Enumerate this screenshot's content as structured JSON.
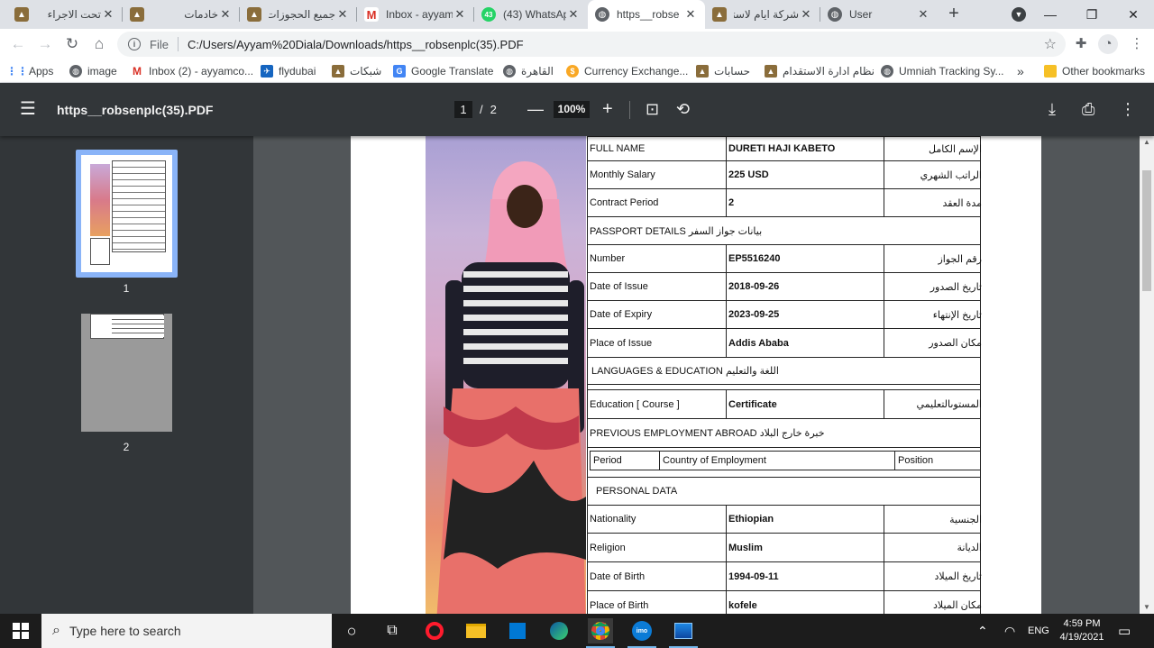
{
  "tabs": [
    {
      "title": "تحت الاجراء",
      "active": false
    },
    {
      "title": "خادمات",
      "active": false
    },
    {
      "title": "جميع الحجوزات",
      "active": false
    },
    {
      "title": "Inbox - ayyam",
      "active": false
    },
    {
      "title": "(43) WhatsApp",
      "active": false
    },
    {
      "title": "https__robse",
      "active": true
    },
    {
      "title": "شركة ايام لاستقدام",
      "active": false
    },
    {
      "title": "User",
      "active": false
    }
  ],
  "toolbar": {
    "scheme_label": "File",
    "url": "C:/Users/Ayyam%20Diala/Downloads/https__robsenplc(35).PDF"
  },
  "bookmarks": [
    {
      "label": "Apps",
      "icon": "apps-grid-icon"
    },
    {
      "label": "image",
      "icon": "globe-icon"
    },
    {
      "label": "Inbox (2) - ayyamco...",
      "icon": "gmail-icon"
    },
    {
      "label": "flydubai",
      "icon": "plane-icon"
    },
    {
      "label": "شبكات",
      "icon": "site-icon"
    },
    {
      "label": "Google Translate",
      "icon": "translate-icon"
    },
    {
      "label": "القاهرة",
      "icon": "globe-icon"
    },
    {
      "label": "Currency Exchange...",
      "icon": "currency-icon"
    },
    {
      "label": "حسابات",
      "icon": "site-icon"
    },
    {
      "label": "نظام ادارة الاستقدام",
      "icon": "site-icon"
    },
    {
      "label": "Umniah Tracking Sy...",
      "icon": "globe-icon"
    }
  ],
  "bookmarks_more": "»",
  "other_bookmarks": "Other bookmarks",
  "pdf": {
    "title": "https__robsenplc(35).PDF",
    "current_page": "1",
    "page_separator": "/",
    "total_pages": "2",
    "zoom": "100%",
    "thumbnails": [
      {
        "num": "1"
      },
      {
        "num": "2"
      }
    ]
  },
  "form": {
    "rows": [
      {
        "en": "FULL NAME",
        "value": "DURETI HAJI KABETO",
        "ar": "الإسم الكامل"
      },
      {
        "en": "Monthly Salary",
        "value": "225 USD",
        "ar": "الراتب الشهري"
      },
      {
        "en": "Contract Period",
        "value": "2",
        "ar": "مدة العقد"
      }
    ],
    "passport_section": "PASSPORT DETAILS بيانات جواز السفر",
    "passport_rows": [
      {
        "en": "Number",
        "value": "EP5516240",
        "ar": "رقم الجواز"
      },
      {
        "en": "Date of Issue",
        "value": "2018-09-26",
        "ar": "تاريخ الصدور"
      },
      {
        "en": "Date of Expiry",
        "value": "2023-09-25",
        "ar": "تاريخ الإنتهاء"
      },
      {
        "en": "Place of Issue",
        "value": "Addis Ababa",
        "ar": "مكان الصدور"
      }
    ],
    "languages_section": "LANGUAGES & EDUCATION اللغة والتعليم",
    "education_row": {
      "en": "Education [ Course ]",
      "value": "Certificate",
      "ar": "المستوىالتعليمي"
    },
    "employment_section": "PREVIOUS EMPLOYMENT ABROAD خبرة خارج البلاد",
    "employment_headers": [
      "Period",
      "Country of Employment",
      "Position"
    ],
    "personal_section": "PERSONAL DATA",
    "personal_rows": [
      {
        "en": "Nationality",
        "value": "Ethiopian",
        "ar": "الجنسية"
      },
      {
        "en": "Religion",
        "value": "Muslim",
        "ar": "الديانة"
      },
      {
        "en": "Date of Birth",
        "value": "1994-09-11",
        "ar": "تاريخ الميلاد"
      },
      {
        "en": "Place of Birth",
        "value": "kofele",
        "ar": "مكان الميلاد"
      }
    ]
  },
  "taskbar": {
    "search_placeholder": "Type here to search",
    "language": "ENG",
    "time": "4:59 PM",
    "date": "4/19/2021"
  }
}
